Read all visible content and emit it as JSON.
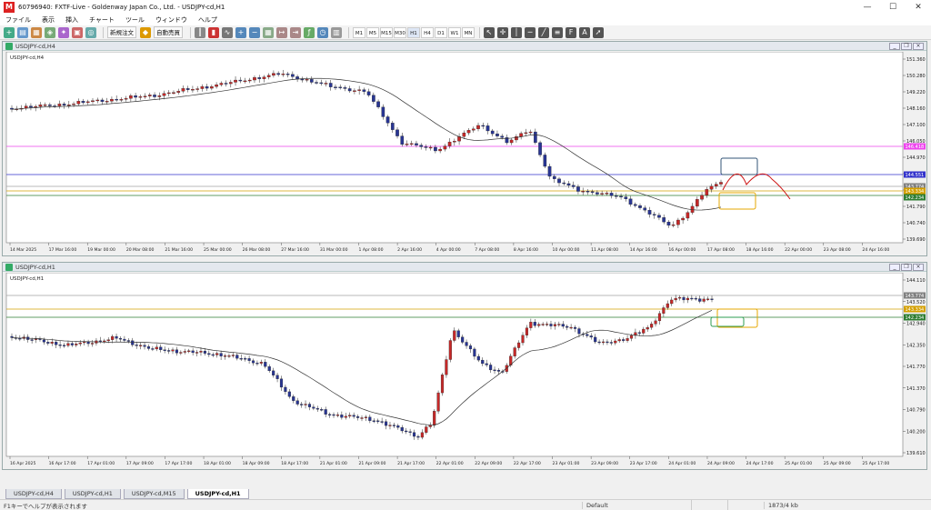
{
  "window": {
    "title": "60796940: FXTF-Live - Goldenway Japan Co., Ltd. - USDJPY-cd,H1",
    "app_icon": "mt4-icon",
    "ctrl_minimize": "—",
    "ctrl_maximize": "☐",
    "ctrl_close": "✕"
  },
  "menu": [
    "ファイル",
    "表示",
    "挿入",
    "チャート",
    "ツール",
    "ウィンドウ",
    "ヘルプ"
  ],
  "toolbar": {
    "new_order": "新規注文",
    "auto_trading": "自動売買",
    "timeframes": [
      "M1",
      "M5",
      "M15",
      "M30",
      "H1",
      "H4",
      "D1",
      "W1",
      "MN"
    ],
    "active_timeframe": "H1"
  },
  "chart_h4": {
    "window_title": "USDJPY-cd,H4",
    "label": "USDJPY-cd,H4",
    "price_ticks": [
      "151.360",
      "150.280",
      "149.220",
      "148.160",
      "147.100",
      "146.050",
      "144.970",
      "143.910",
      "142.870",
      "141.790",
      "140.740",
      "139.690"
    ],
    "time_ticks": [
      "14 Mar 2025",
      "17 Mar 16:00",
      "19 Mar 00:00",
      "20 Mar 08:00",
      "21 Mar 16:00",
      "25 Mar 00:00",
      "26 Mar 08:00",
      "27 Mar 16:00",
      "31 Mar 00:00",
      "1 Apr 08:00",
      "2 Apr 16:00",
      "4 Apr 00:00",
      "7 Apr 08:00",
      "8 Apr 16:00",
      "10 Apr 00:00",
      "11 Apr 08:00",
      "14 Apr 16:00",
      "16 Apr 00:00",
      "17 Apr 08:00",
      "18 Apr 16:00",
      "22 Apr 00:00",
      "23 Apr 08:00",
      "24 Apr 16:00"
    ],
    "price_badges": [
      {
        "text": "146.418",
        "color": "#ee44ee"
      },
      {
        "text": "144.551",
        "color": "#3333cc"
      },
      {
        "text": "143.774",
        "color": "#808080"
      },
      {
        "text": "143.334",
        "color": "#d4a000"
      },
      {
        "text": "142.234",
        "color": "#2e7d32"
      }
    ]
  },
  "chart_h1": {
    "window_title": "USDJPY-cd,H1",
    "label": "USDJPY-cd,H1",
    "price_ticks": [
      "144.110",
      "143.520",
      "142.940",
      "142.350",
      "141.770",
      "141.370",
      "140.790",
      "140.200",
      "139.610"
    ],
    "time_ticks": [
      "16 Apr 2025",
      "16 Apr 17:00",
      "17 Apr 01:00",
      "17 Apr 09:00",
      "17 Apr 17:00",
      "18 Apr 01:00",
      "18 Apr 09:00",
      "18 Apr 17:00",
      "21 Apr 01:00",
      "21 Apr 09:00",
      "21 Apr 17:00",
      "22 Apr 01:00",
      "22 Apr 09:00",
      "22 Apr 17:00",
      "23 Apr 01:00",
      "23 Apr 09:00",
      "23 Apr 17:00",
      "24 Apr 01:00",
      "24 Apr 09:00",
      "24 Apr 17:00",
      "25 Apr 01:00",
      "25 Apr 09:00",
      "25 Apr 17:00"
    ],
    "price_badges": [
      {
        "text": "143.774",
        "color": "#808080"
      },
      {
        "text": "143.334",
        "color": "#d4a000"
      },
      {
        "text": "142.234",
        "color": "#2e7d32"
      }
    ]
  },
  "colors": {
    "bull": "#c62828",
    "bear": "#283593",
    "ma": "#333333"
  },
  "tabs": [
    "USDJPY-cd,H4",
    "USDJPY-cd,H1",
    "USDJPY-cd,M15",
    "USDJPY-cd,H1"
  ],
  "active_tab": 3,
  "status": {
    "help": "F1キーでヘルプが表示されます",
    "profile": "Default",
    "connection": "1873/4 kb"
  }
}
